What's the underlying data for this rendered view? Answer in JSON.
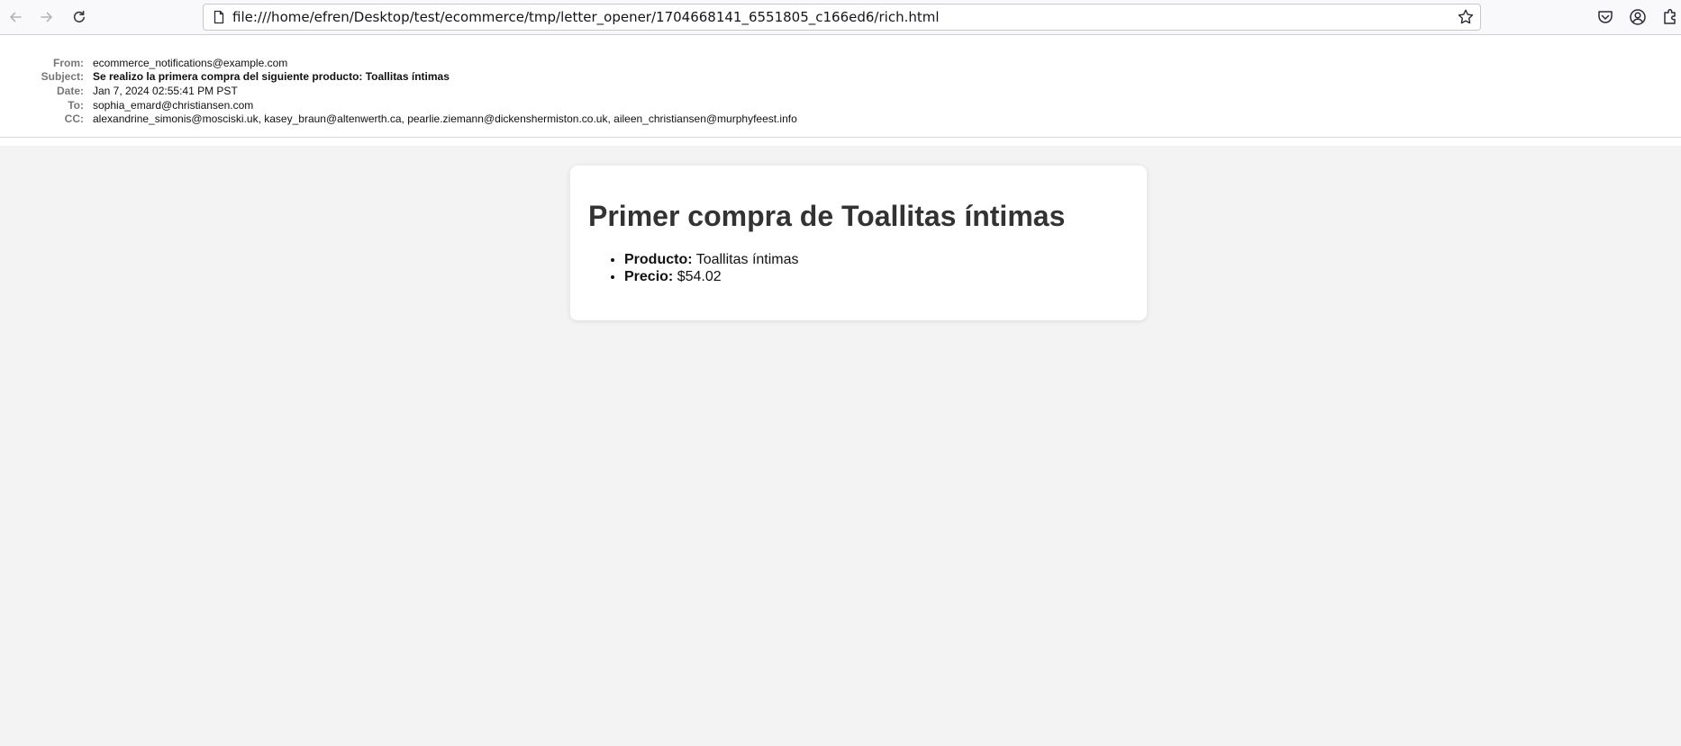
{
  "browser": {
    "url": "file:///home/efren/Desktop/test/ecommerce/tmp/letter_opener/1704668141_6551805_c166ed6/rich.html",
    "nav_icons": [
      "back-arrow-icon",
      "forward-arrow-icon",
      "reload-icon"
    ],
    "right_icons": [
      "pocket-icon",
      "account-icon",
      "extensions-icon"
    ]
  },
  "email": {
    "labels": {
      "from": "From:",
      "subject": "Subject:",
      "date": "Date:",
      "to": "To:",
      "cc": "CC:"
    },
    "from": "ecommerce_notifications@example.com",
    "subject": "Se realizo la primera compra del siguiente producto: Toallitas íntimas",
    "date": "Jan 7, 2024 02:55:41 PM PST",
    "to": "sophia_emard@christiansen.com",
    "cc": "alexandrine_simonis@mosciski.uk, kasey_braun@altenwerth.ca, pearlie.ziemann@dickenshermiston.co.uk, aileen_christiansen@murphyfeest.info"
  },
  "message": {
    "title": "Primer compra de Toallitas íntimas",
    "items": [
      {
        "label": "Producto:",
        "value": "Toallitas íntimas"
      },
      {
        "label": "Precio:",
        "value": "$54.02"
      }
    ]
  },
  "colors": {
    "page_background": "#f3f3f3",
    "card_background": "#ffffff",
    "title_color": "#333333",
    "label_color": "#777777"
  }
}
